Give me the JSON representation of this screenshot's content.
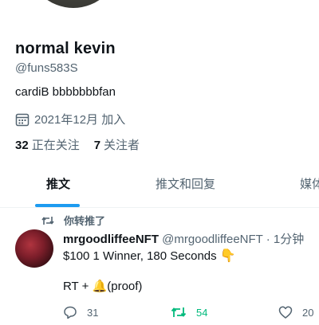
{
  "profile": {
    "display_name": "normal kevin",
    "handle": "@funs583S",
    "bio": "cardiB bbbbbbbfan",
    "joined": "2021年12月 加入",
    "following_count": "32",
    "following_label": "正在关注",
    "followers_count": "7",
    "followers_label": "关注者"
  },
  "tabs": [
    {
      "label": "推文"
    },
    {
      "label": "推文和回复"
    },
    {
      "label": "媒体"
    }
  ],
  "tweet": {
    "retweet_context": "你转推了",
    "author_name": "mrgoodliffeeNFT",
    "author_handle": "@mrgoodliffeeNFT",
    "separator": "·",
    "time": "1分钟",
    "line1": "$100 1 Winner, 180 Seconds",
    "line2_prefix": "RT +",
    "line2_suffix": "(proof)",
    "reply_count": "31",
    "retweet_count": "54",
    "like_count": "20"
  },
  "colors": {
    "accent": "#1d9bf0",
    "retweet_green": "#00ba7c",
    "secondary_text": "#536471"
  }
}
